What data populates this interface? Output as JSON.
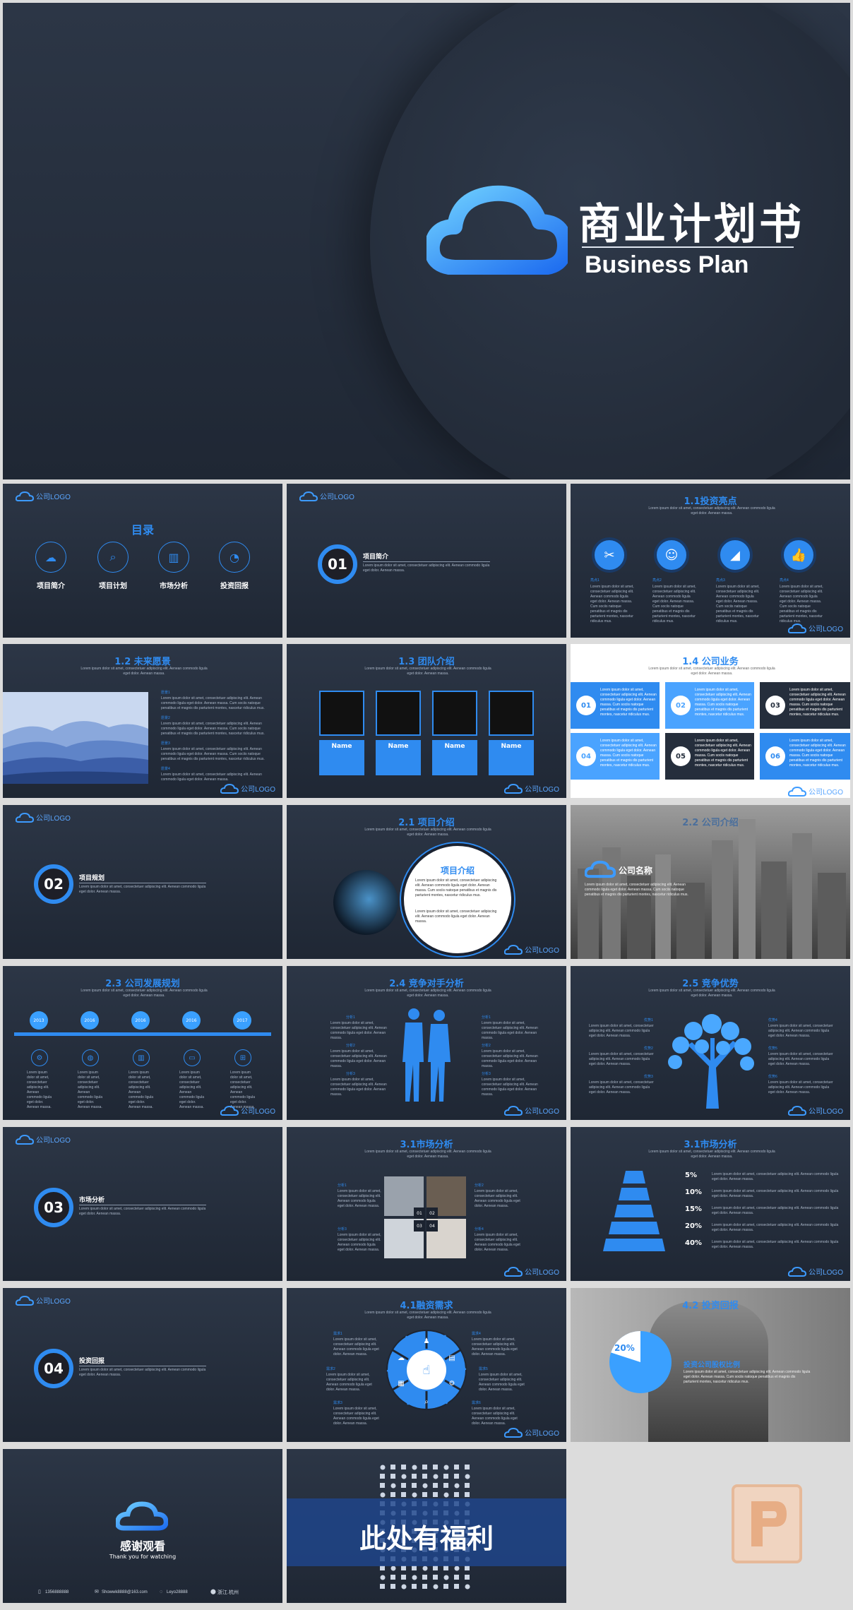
{
  "hero": {
    "title": "商业计划书",
    "subtitle": "Business Plan"
  },
  "logo_text": "公司LOGO",
  "lorem_short": "Lorem ipsum dolor sit amet, consectetuer adipiscing elit. Aenean commodo ligula eget dolor. Aenean massa.",
  "lorem_long": "Lorem ipsum dolor sit amet, consectetuer adipiscing elit. Aenean commodo ligula eget dolor. Aenean massa. Cum sociis natoque penatibus et magnis dis parturient montes, nascetur ridiculus mus.",
  "toc": {
    "title": "目录",
    "items": [
      "项目简介",
      "项目计划",
      "市场分析",
      "投资回报"
    ]
  },
  "sections": [
    {
      "num": "01",
      "title": "项目简介"
    },
    {
      "num": "02",
      "title": "项目规划"
    },
    {
      "num": "03",
      "title": "市场分析"
    },
    {
      "num": "04",
      "title": "投资回报"
    }
  ],
  "s_invest": {
    "title": "1.1投资亮点",
    "items": [
      "亮点1",
      "亮点2",
      "亮点3",
      "亮点4"
    ]
  },
  "s_future": {
    "title": "1.2 未来愿景",
    "items": [
      "愿景1",
      "愿景2",
      "愿景3",
      "愿景4"
    ]
  },
  "s_team": {
    "title": "1.3 团队介绍",
    "name": "Name"
  },
  "s_business": {
    "title": "1.4 公司业务",
    "nums": [
      "01",
      "02",
      "03",
      "04",
      "05",
      "06"
    ]
  },
  "s_project": {
    "title": "2.1 项目介绍",
    "circle_title": "项目介绍"
  },
  "s_company": {
    "title": "2.2 公司介绍",
    "name": "公司名称"
  },
  "s_plan": {
    "title": "2.3 公司发展规划",
    "years": [
      "2013",
      "2016",
      "2016",
      "2016",
      "2017"
    ],
    "label": "规划1"
  },
  "s_compete": {
    "title": "2.4 竞争对手分析",
    "items": [
      "分析1",
      "分析2",
      "分析3",
      "分析4"
    ]
  },
  "s_adv": {
    "title": "2.5 竞争优势",
    "items": [
      "优势1",
      "优势2",
      "优势3",
      "优势4",
      "优势5",
      "优势6"
    ]
  },
  "s_market1": {
    "title": "3.1市场分析",
    "items": [
      "分析1",
      "分析2",
      "分析3",
      "分析4"
    ],
    "tiles": [
      "01",
      "02",
      "03",
      "04"
    ]
  },
  "s_market2": {
    "title": "3.1市场分析",
    "pcts": [
      "5%",
      "10%",
      "15%",
      "20%",
      "40%"
    ],
    "bar_label": "Lorem ipsum"
  },
  "s_finance": {
    "title": "4.1融资需求",
    "items": [
      "需求1",
      "需求2",
      "需求3",
      "需求4",
      "需求5",
      "需求6"
    ]
  },
  "s_return": {
    "title": "4.2 投资回报",
    "pct": "20%",
    "headline": "投资公司股权比例"
  },
  "thanks": {
    "title": "感谢观看",
    "subtitle": "Thank you for watching",
    "contacts": [
      "1356888888",
      "Showwk8888@163.com",
      "Leyo28888",
      "浙江.杭州"
    ]
  },
  "bonus": {
    "title": "此处有福利"
  },
  "colors": {
    "accent": "#2f8bf0",
    "dark": "#252e3c"
  }
}
